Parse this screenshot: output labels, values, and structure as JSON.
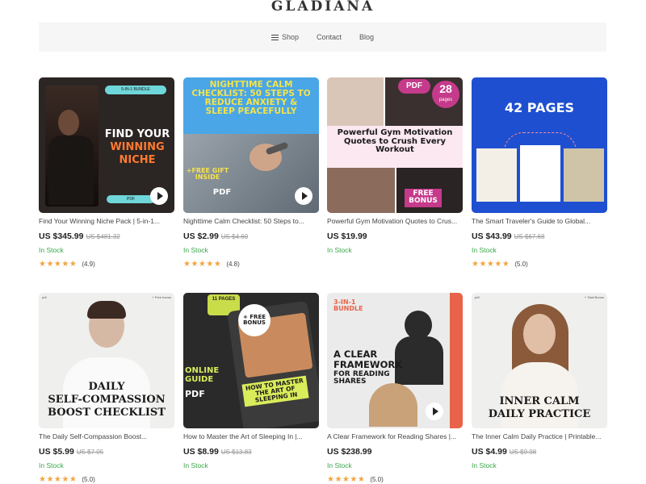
{
  "brand": {
    "logo": "GLADIANA"
  },
  "nav": {
    "shop": "Shop",
    "contact": "Contact",
    "blog": "Blog"
  },
  "products": [
    {
      "title": "Find Your Winning Niche Pack | 5-in-1...",
      "price": "US $345.99",
      "old_price": "US $481.32",
      "stock": "In Stock",
      "stars": "★★★★★",
      "rating": "(4.9)",
      "art": {
        "badge": "5-IN-1 BUNDLE",
        "line1": "FIND YOUR",
        "line2": "WINNING",
        "line3": "NICHE",
        "tag": "PDF"
      }
    },
    {
      "title": "Nighttime Calm Checklist: 50 Steps to...",
      "price": "US $2.99",
      "old_price": "US $4.60",
      "stock": "In Stock",
      "stars": "★★★★★",
      "rating": "(4.8)",
      "art": {
        "headline": "NIGHTTIME CALM CHECKLIST: 50 STEPS TO REDUCE ANXIETY & SLEEP PEACEFULLY",
        "gift": "+FREE GIFT INSIDE",
        "tag": "PDF"
      }
    },
    {
      "title": "Powerful Gym Motivation Quotes to Crus...",
      "price": "US $19.99",
      "old_price": "",
      "stock": "In Stock",
      "stars": "",
      "rating": "",
      "art": {
        "pdf": "PDF",
        "pages_num": "28",
        "pages": "pages",
        "headline": "Powerful Gym Motivation Quotes to Crush Every Workout",
        "bonus": "FREE BONUS"
      }
    },
    {
      "title": "The Smart Traveler's Guide to Global...",
      "price": "US $43.99",
      "old_price": "US $67.68",
      "stock": "In Stock",
      "stars": "★★★★★",
      "rating": "(5.0)",
      "art": {
        "headline": "42 PAGES"
      }
    },
    {
      "title": "The Daily Self-Compassion Boost...",
      "price": "US $5.99",
      "old_price": "US $7.05",
      "stock": "In Stock",
      "stars": "★★★★★",
      "rating": "(5.0)",
      "art": {
        "corner_left": "pdf",
        "corner_right": "+ Free bonus",
        "line1": "DAILY",
        "line2": "SELF-COMPASSION",
        "line3": "BOOST CHECKLIST"
      }
    },
    {
      "title": "How to Master the Art of Sleeping In |...",
      "price": "US $8.99",
      "old_price": "US $13.83",
      "stock": "In Stock",
      "stars": "",
      "rating": "",
      "art": {
        "pages_tag": "11 PAGES",
        "bonus": "+ FREE BONUS",
        "guide": "ONLINE GUIDE",
        "tag": "PDF",
        "book": "HOW TO MASTER THE ART OF SLEEPING IN"
      }
    },
    {
      "title": "A Clear Framework for Reading Shares |...",
      "price": "US $238.99",
      "old_price": "",
      "stock": "In Stock",
      "stars": "★★★★★",
      "rating": "(5.0)",
      "art": {
        "bundle": "3-IN-1 BUNDLE",
        "headline1": "A CLEAR",
        "headline2": "FRAMEWORK",
        "headline3": "FOR READING SHARES"
      }
    },
    {
      "title": "The Inner Calm Daily Practice | Printable...",
      "price": "US $4.99",
      "old_price": "US $9.98",
      "stock": "In Stock",
      "stars": "",
      "rating": "",
      "art": {
        "corner_left": "pdf",
        "corner_right": "+ Total Bonus",
        "line1": "INNER CALM",
        "line2": "DAILY PRACTICE"
      }
    }
  ],
  "colors": {
    "in_stock": "#3aa64b",
    "star": "#f2a541",
    "nav_bg": "#f6f6f6"
  }
}
